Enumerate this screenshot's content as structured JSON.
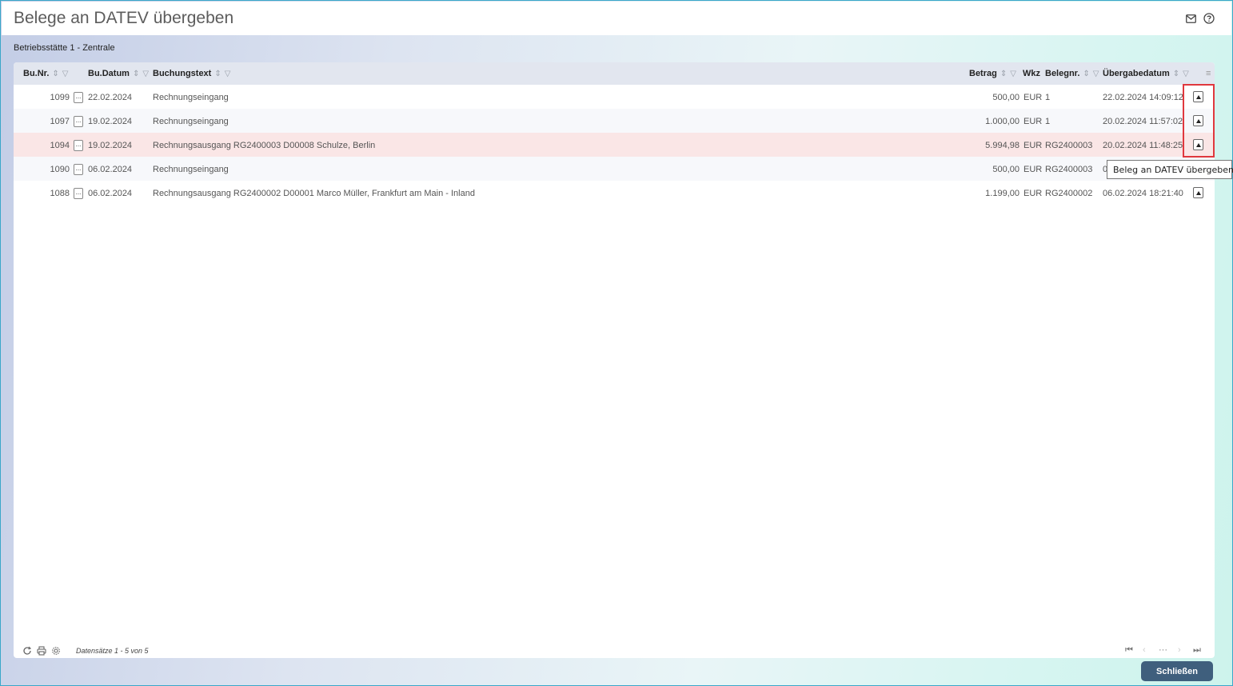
{
  "window": {
    "title": "Belege an DATEV übergeben"
  },
  "header_icons": {
    "mail": "mail-icon",
    "help": "help-icon"
  },
  "location": "Betriebsstätte 1 - Zentrale",
  "table": {
    "columns": {
      "bunr": "Bu.Nr.",
      "budatum": "Bu.Datum",
      "buchungstext": "Buchungstext",
      "betrag": "Betrag",
      "wkz": "Wkz",
      "belegnr": "Belegnr.",
      "uebergabedatum": "Übergabedatum"
    },
    "rows": [
      {
        "bunr": "1099",
        "budatum": "22.02.2024",
        "buchungstext": "Rechnungseingang",
        "betrag": "500,00",
        "wkz": "EUR",
        "belegnr": "1",
        "uebergabedatum": "22.02.2024 14:09:12"
      },
      {
        "bunr": "1097",
        "budatum": "19.02.2024",
        "buchungstext": "Rechnungseingang",
        "betrag": "1.000,00",
        "wkz": "EUR",
        "belegnr": "1",
        "uebergabedatum": "20.02.2024 11:57:02"
      },
      {
        "bunr": "1094",
        "budatum": "19.02.2024",
        "buchungstext": "Rechnungsausgang RG2400003 D00008 Schulze, Berlin",
        "betrag": "5.994,98",
        "wkz": "EUR",
        "belegnr": "RG2400003",
        "uebergabedatum": "20.02.2024 11:48:25"
      },
      {
        "bunr": "1090",
        "budatum": "06.02.2024",
        "buchungstext": "Rechnungseingang",
        "betrag": "500,00",
        "wkz": "EUR",
        "belegnr": "RG2400003",
        "uebergabedatum": "0"
      },
      {
        "bunr": "1088",
        "budatum": "06.02.2024",
        "buchungstext": "Rechnungsausgang RG2400002 D00001 Marco Müller, Frankfurt am Main - Inland",
        "betrag": "1.199,00",
        "wkz": "EUR",
        "belegnr": "RG2400002",
        "uebergabedatum": "06.02.2024 18:21:40"
      }
    ],
    "row_button_label": "..."
  },
  "tooltip": "Beleg an DATEV übergeben",
  "footer": {
    "records": "Datensätze 1 - 5 von 5",
    "pager_more": "···"
  },
  "close_button": "Schließen",
  "colors": {
    "highlight_row": "#fae6e6",
    "annotation_box": "#e0383e",
    "close_button": "#3f5f7d"
  }
}
